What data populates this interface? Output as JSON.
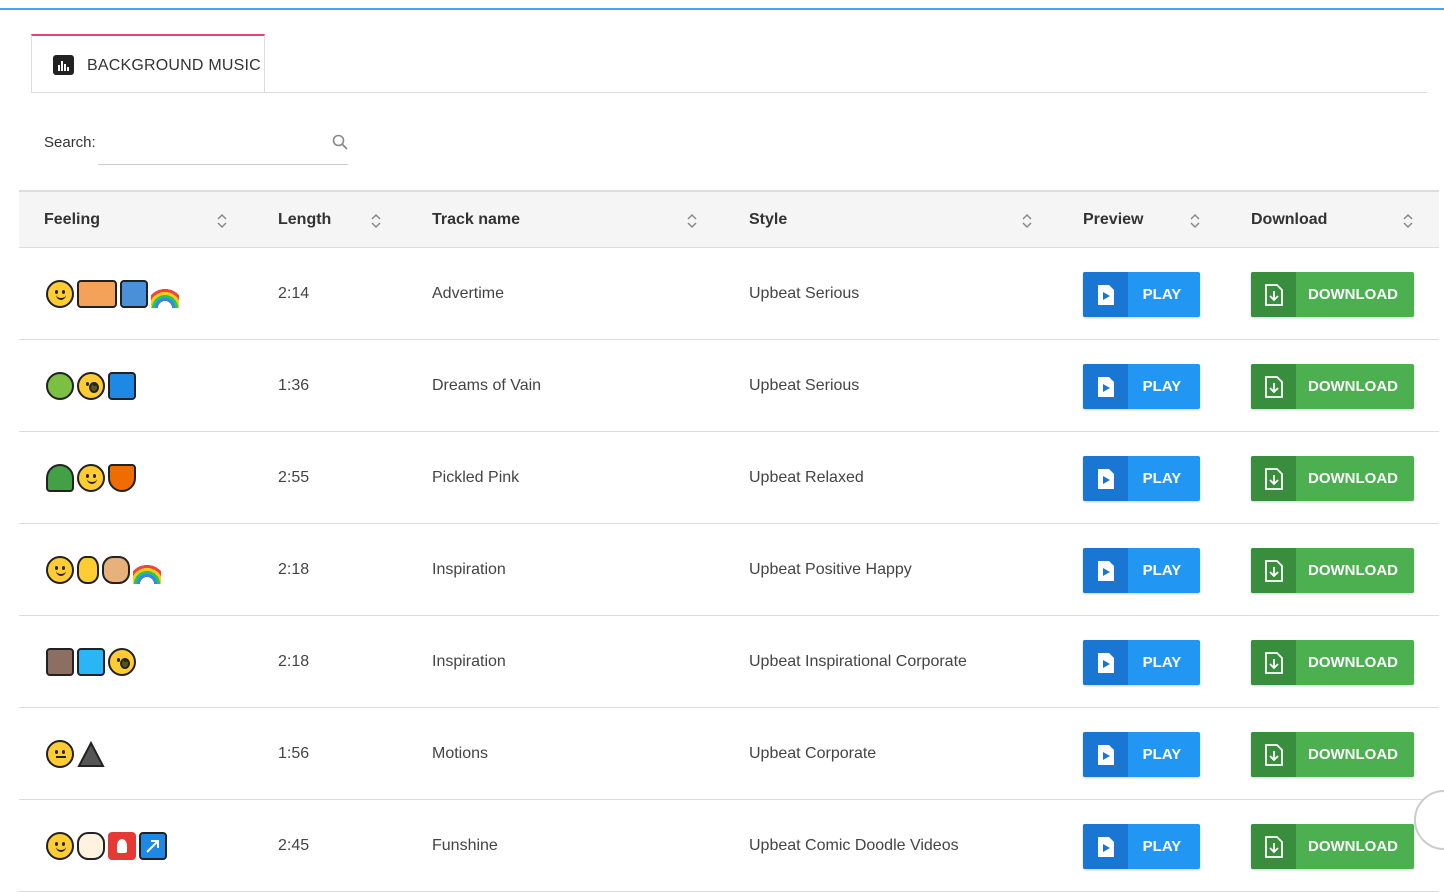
{
  "tab": {
    "label": "BACKGROUND MUSIC"
  },
  "search": {
    "label": "Search:",
    "placeholder": ""
  },
  "columns": [
    "Feeling",
    "Length",
    "Track name",
    "Style",
    "Preview",
    "Download"
  ],
  "rows": [
    {
      "feelings": [
        "wink-face",
        "family",
        "shirt",
        "rainbow"
      ],
      "length": "2:14",
      "name": "Advertime",
      "style": "Upbeat Serious",
      "play": "PLAY",
      "download": "DOWNLOAD"
    },
    {
      "feelings": [
        "snake",
        "surprised-face",
        "office-building"
      ],
      "length": "1:36",
      "name": "Dreams of Vain",
      "style": "Upbeat Serious",
      "play": "PLAY",
      "download": "DOWNLOAD"
    },
    {
      "feelings": [
        "palm-tree",
        "smiling-face",
        "tropical-drink"
      ],
      "length": "2:55",
      "name": "Pickled Pink",
      "style": "Upbeat Relaxed",
      "play": "PLAY",
      "download": "DOWNLOAD"
    },
    {
      "feelings": [
        "smiling-face",
        "vulcan-hand",
        "hamster",
        "rainbow"
      ],
      "length": "2:18",
      "name": "Inspiration",
      "style": "Upbeat Positive Happy",
      "play": "PLAY",
      "download": "DOWNLOAD"
    },
    {
      "feelings": [
        "climber",
        "rowing-boat",
        "surprised-face"
      ],
      "length": "2:18",
      "name": "Inspiration",
      "style": "Upbeat Inspirational Corporate",
      "play": "PLAY",
      "download": "DOWNLOAD"
    },
    {
      "feelings": [
        "expressionless-face",
        "mountain"
      ],
      "length": "1:56",
      "name": "Motions",
      "style": "Upbeat Corporate",
      "play": "PLAY",
      "download": "DOWNLOAD"
    },
    {
      "feelings": [
        "zany-face",
        "dog",
        "baby-symbol",
        "up-right-arrow"
      ],
      "length": "2:45",
      "name": "Funshine",
      "style": "Upbeat Comic Doodle Videos",
      "play": "PLAY",
      "download": "DOWNLOAD"
    }
  ],
  "colors": {
    "accent": "#2196f3",
    "download": "#4caf50",
    "tab_border": "#e0457b"
  }
}
